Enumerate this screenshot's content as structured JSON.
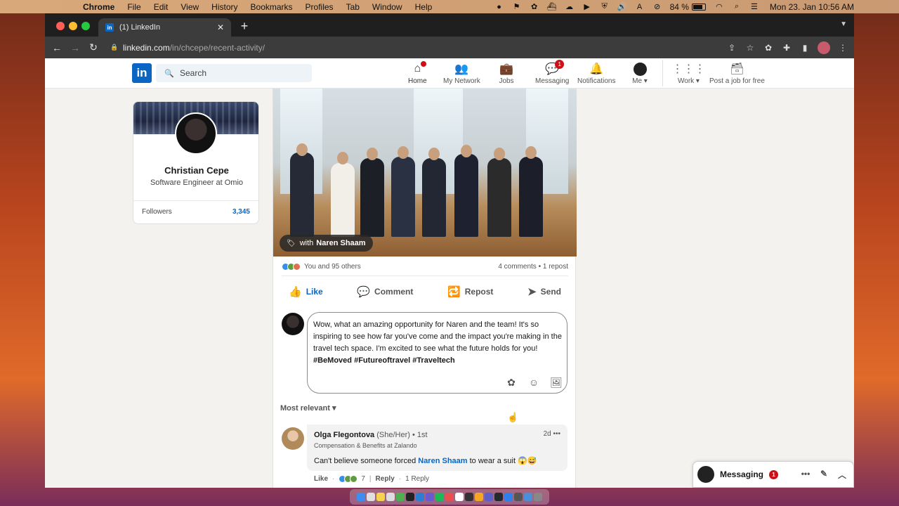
{
  "menubar": {
    "app_name": "Chrome",
    "items": [
      "File",
      "Edit",
      "View",
      "History",
      "Bookmarks",
      "Profiles",
      "Tab",
      "Window",
      "Help"
    ],
    "battery": "84 %",
    "clock": "Mon 23. Jan  10:56 AM"
  },
  "browser": {
    "tab_title": "(1) LinkedIn",
    "url_host": "linkedin.com",
    "url_path": "/in/chcepe/recent-activity/"
  },
  "header": {
    "logo": "in",
    "search_placeholder": "Search",
    "nav": {
      "home": "Home",
      "network": "My Network",
      "jobs": "Jobs",
      "messaging": "Messaging",
      "messaging_badge": "1",
      "notifications": "Notifications",
      "me": "Me ▾",
      "work": "Work ▾",
      "post_job": "Post a job for free"
    }
  },
  "profile": {
    "name": "Christian Cepe",
    "headline": "Software Engineer at Omio",
    "followers_label": "Followers",
    "followers_count": "3,345"
  },
  "post": {
    "tag_prefix": "with",
    "tag_name": "Naren Shaam",
    "reactors": "You and 95 others",
    "counts": "4 comments • 1 repost",
    "actions": {
      "like": "Like",
      "comment": "Comment",
      "repost": "Repost",
      "send": "Send"
    }
  },
  "comment_box": {
    "text": "Wow, what an amazing opportunity for Naren and the team! It's so inspiring to see how far you've come and the impact you're making in the travel tech space. I'm excited to see what the future holds for you! ",
    "hashtags": "#BeMoved #Futureoftravel #Traveltech"
  },
  "sort_label": "Most relevant ▾",
  "reply": {
    "name": "Olga Flegontova",
    "meta": "(She/Her) • 1st",
    "time": "2d",
    "more": "•••",
    "subtitle": "Compensation & Benefits at Zalando",
    "body_prefix": "Can't believe someone forced ",
    "mention": "Naren Shaam",
    "body_suffix": " to wear a suit 😱😅",
    "like": "Like",
    "reaction_count": "7",
    "reply_label": "Reply",
    "reply_count": "1 Reply"
  },
  "messaging": {
    "label": "Messaging",
    "badge": "1"
  },
  "colors": {
    "linkedin_blue": "#0a66c2",
    "badge_red": "#cc1016"
  }
}
